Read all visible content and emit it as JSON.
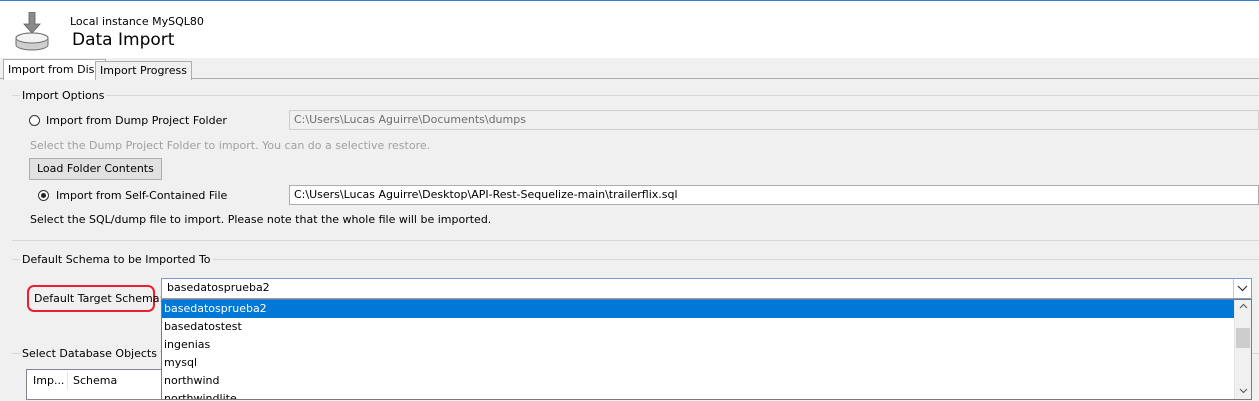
{
  "header": {
    "connection": "Local instance MySQL80",
    "title": "Data Import",
    "icon": "database-import-icon"
  },
  "tabs": [
    {
      "label": "Import from Disk",
      "active": true
    },
    {
      "label": "Import Progress",
      "active": false
    }
  ],
  "import_options": {
    "group_label": "Import Options",
    "dump_folder_radio": "Import from Dump Project Folder",
    "dump_folder_path": "C:\\Users\\Lucas Aguirre\\Documents\\dumps",
    "dump_folder_hint": "Select the Dump Project Folder to import. You can do a selective restore.",
    "load_folder_button": "Load Folder Contents",
    "self_contained_radio": "Import from Self-Contained File",
    "self_contained_path": "C:\\Users\\Lucas Aguirre\\Desktop\\API-Rest-Sequelize-main\\trailerflix.sql",
    "self_contained_hint": "Select the SQL/dump file to import. Please note that the whole file will be imported."
  },
  "default_schema": {
    "group_label": "Default Schema to be Imported To",
    "target_label": "Default Target Schema:",
    "selected_value": "basedatosprueba2",
    "options": [
      "basedatosprueba2",
      "basedatostest",
      "ingenias",
      "mysql",
      "northwind",
      "northwindlite"
    ]
  },
  "objects_section": {
    "group_label": "Select Database Objects to Import",
    "columns": [
      "Imp...",
      "Schema"
    ]
  },
  "colors": {
    "accent": "#0078d7",
    "highlight_box": "#e8202f"
  }
}
